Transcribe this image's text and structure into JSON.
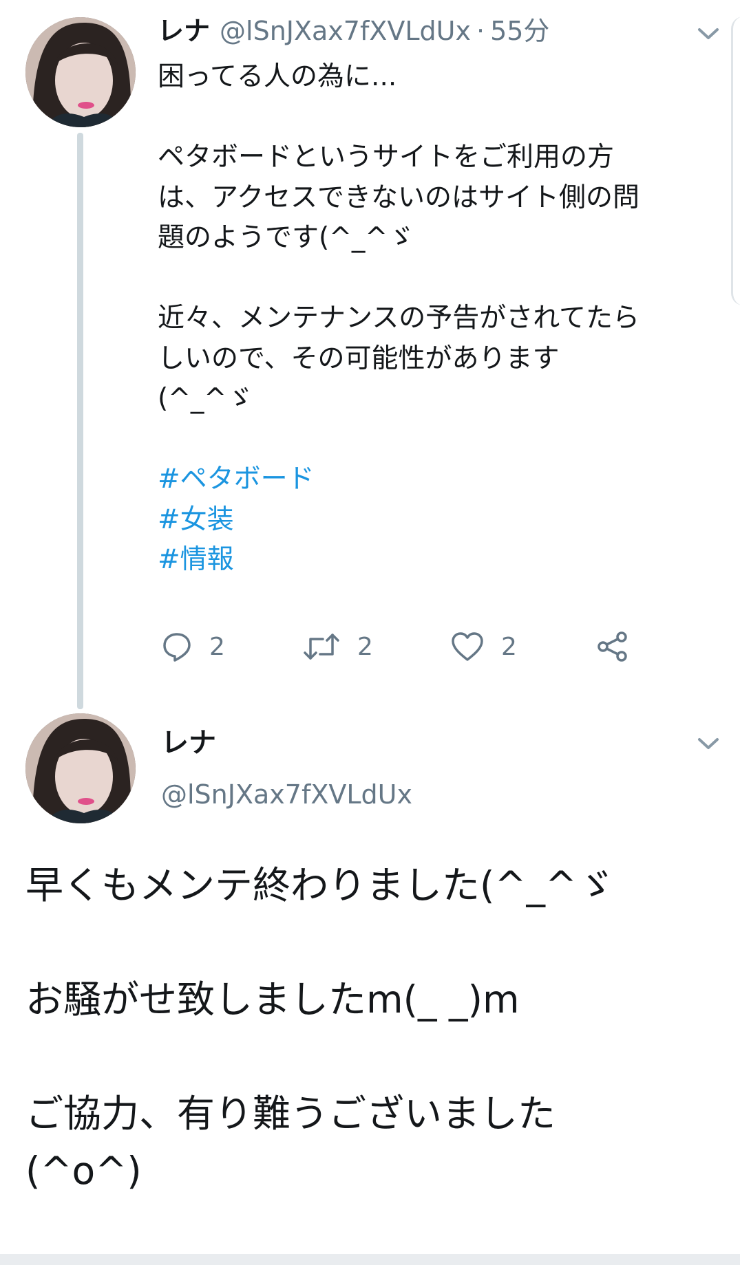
{
  "tweet1": {
    "display_name": "レナ",
    "handle": "@lSnJXax7fXVLdUx",
    "separator": "·",
    "time": "55分",
    "lines": [
      "困ってる人の為に...",
      "",
      "ペタボードというサイトをご利用の方",
      "は、アクセスできないのはサイト側の問",
      "題のようです(^_^ゞ",
      "",
      "近々、メンテナンスの予告がされてたら",
      "しいので、その可能性があります",
      "(^_^ゞ",
      ""
    ],
    "hashtags": [
      "#ペタボード",
      "#女装",
      "#情報"
    ],
    "reply_count": "2",
    "retweet_count": "2",
    "like_count": "2"
  },
  "tweet2": {
    "display_name": "レナ",
    "handle": "@lSnJXax7fXVLdUx",
    "lines": [
      "早くもメンテ終わりました(^_^ゞ",
      "",
      "お騒がせ致しましたm(_ _)m",
      "",
      "ご協力、有り難うございました",
      "(^o^)"
    ]
  },
  "icons": {
    "reply": "reply-icon",
    "retweet": "retweet-icon",
    "like": "heart-icon",
    "share": "share-icon",
    "menu": "chevron-down-icon"
  },
  "colors": {
    "hashtag": "#1b95e0",
    "secondary_text": "#657786",
    "thread_line": "#cfd9de"
  }
}
